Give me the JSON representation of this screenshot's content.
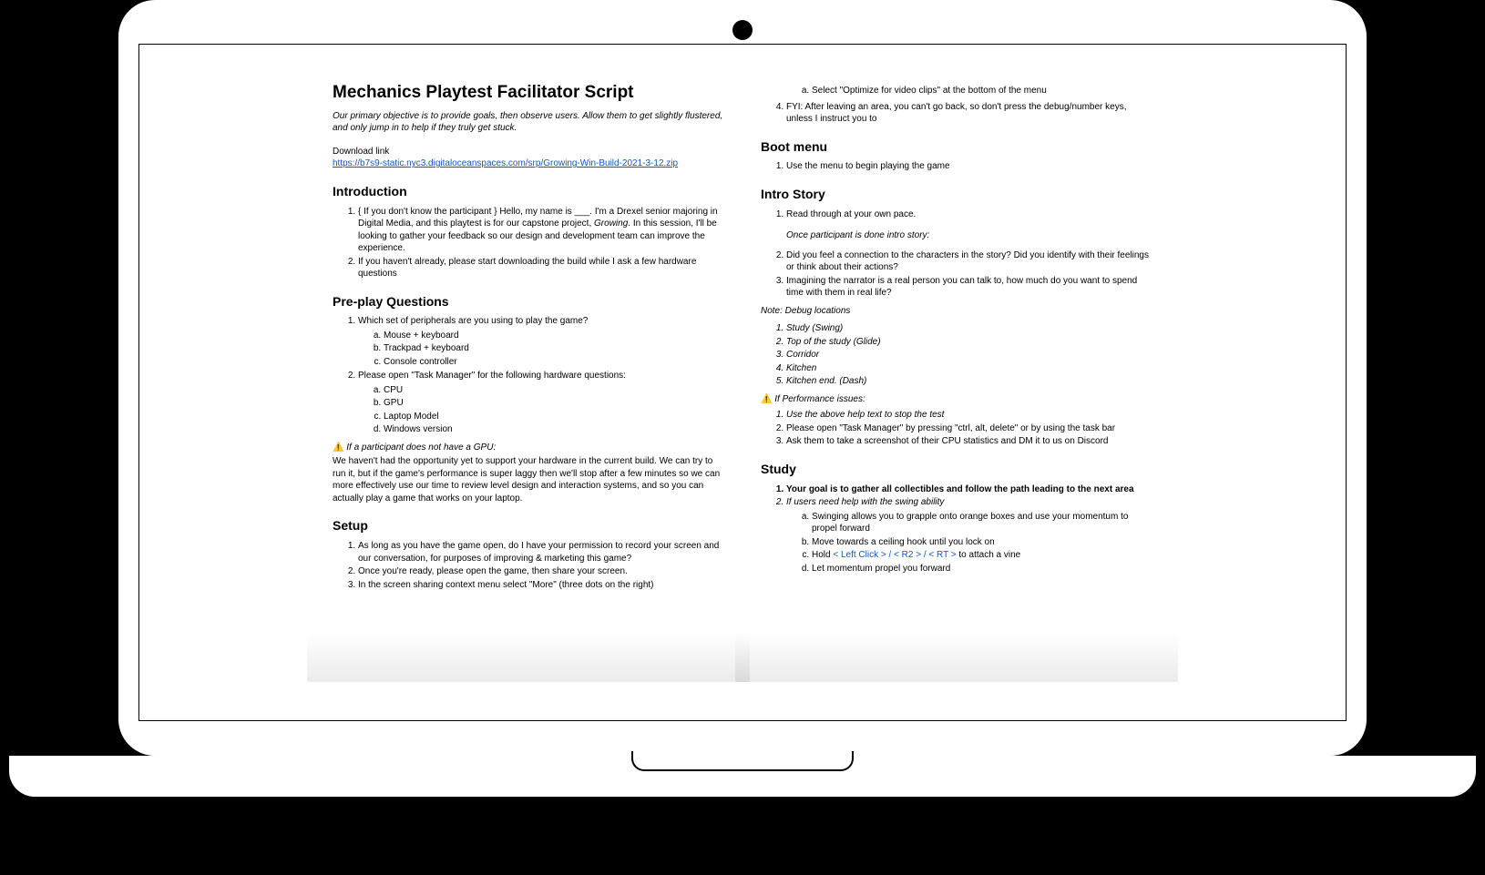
{
  "page1": {
    "title": "Mechanics Playtest Facilitator Script",
    "subtitle": "Our primary objective is to provide goals, then observe users. Allow them to get slightly flustered, and only jump in to help if they truly get stuck.",
    "downloadLabel": "Download link",
    "downloadUrl": "https://b7s9-static.nyc3.digitaloceanspaces.com/srp/Growing-Win-Build-2021-3-12.zip",
    "introHeading": "Introduction",
    "intro1a": "{ If you don't know the participant } Hello, my name is ___. I'm a Drexel senior majoring in Digital Media, and this playtest is for our capstone project, ",
    "intro1b": "Growing",
    "intro1c": ". In this session, I'll be looking to gather your feedback so our design and development team can improve the experience.",
    "intro2": "If you haven't already, please start downloading the build while I ask a few hardware questions",
    "preHeading": "Pre-play Questions",
    "pp1": "Which set of peripherals are you using to play the game?",
    "pp1a": "Mouse + keyboard",
    "pp1b": "Trackpad + keyboard",
    "pp1c": "Console controller",
    "pp2": "Please open \"Task Manager\" for the following hardware questions:",
    "pp2a": "CPU",
    "pp2b": "GPU",
    "pp2c": "Laptop Model",
    "pp2d": "Windows version",
    "warnGpu": "If a participant does not have a GPU:",
    "warnGpuBody": "We haven't had the opportunity yet to support your hardware in the current build. We can try to run it, but if the game's performance is super laggy then we'll stop after a few minutes so we can more effectively use our time to review level design and interaction systems, and so you can actually play a game that works on your laptop.",
    "setupHeading": "Setup",
    "setup1": "As long as you have the game open, do I have your permission to record your screen and our conversation, for purposes of improving & marketing this game?",
    "setup2": "Once you're ready, please open the game, then share your screen.",
    "setup3": "In the screen sharing context menu select \"More\" (three dots on the right)"
  },
  "page2": {
    "cont3a": "Select \"Optimize for video clips\" at the bottom of the menu",
    "cont4": "FYI: After leaving an area, you can't go back, so don't press the debug/number keys, unless I instruct you to",
    "bootHeading": "Boot menu",
    "boot1": "Use the menu to begin playing the game",
    "introStoryHeading": "Intro Story",
    "is1": "Read through at your own pace.",
    "isDone": "Once participant is done intro story:",
    "is2": "Did you feel a connection to the characters in the story? Did you identify with their feelings or think about their actions?",
    "is3": "Imagining the narrator is a real person you can talk to, how much do you want to spend time with them in real life?",
    "noteHead": "Note: Debug locations",
    "loc1": "Study (Swing)",
    "loc2": "Top of the study (Glide)",
    "loc3": "Corridor",
    "loc4": "Kitchen",
    "loc5": "Kitchen end. (Dash)",
    "perfWarn": "If Performance issues:",
    "perf1": "Use the above help text to stop the test",
    "perf2": "Please open \"Task Manager\" by pressing \"ctrl, alt, delete\" or by using the task bar",
    "perf3": "Ask them to take a screenshot of their CPU statistics and DM it to us on Discord",
    "studyHeading": "Study",
    "study1": "Your goal is to gather all collectibles and follow the path leading to the next area",
    "study2": "If users need help with the swing ability",
    "study2a": "Swinging allows you to grapple onto orange boxes and use your momentum to propel forward",
    "study2b": "Move towards a ceiling hook until you lock on",
    "study2cPre": "Hold ",
    "study2cKey": "< Left Click > / < R2 > / < RT >",
    "study2cPost": " to attach a vine",
    "study2d": "Let momentum propel you forward"
  }
}
